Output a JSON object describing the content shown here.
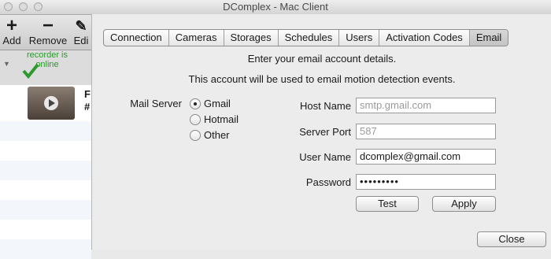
{
  "window": {
    "title": "DComplex - Mac Client"
  },
  "toolbar": {
    "add_label": "Add",
    "remove_label": "Remove",
    "edit_label": "Edi"
  },
  "recorder": {
    "status": "recorder is online"
  },
  "camera": {
    "name_partial": "F",
    "id_partial": "#"
  },
  "tabs": [
    "Connection",
    "Cameras",
    "Storages",
    "Schedules",
    "Users",
    "Activation Codes",
    "Email"
  ],
  "selected_tab": "Email",
  "email": {
    "intro_line1": "Enter your email account details.",
    "intro_line2": "This account will be used to email motion detection events.",
    "mail_server_label": "Mail Server",
    "options": [
      "Gmail",
      "Hotmail",
      "Other"
    ],
    "selected_option": "Gmail",
    "host_name_label": "Host Name",
    "host_name_value": "smtp.gmail.com",
    "server_port_label": "Server Port",
    "server_port_value": "587",
    "user_name_label": "User Name",
    "user_name_value": "dcomplex@gmail.com",
    "password_label": "Password",
    "password_value": "•••••••••",
    "test_label": "Test",
    "apply_label": "Apply",
    "close_label": "Close"
  },
  "colors": {
    "status_green": "#2d9a2d",
    "sheet_bg": "#ececec"
  },
  "icons": [
    "add-icon",
    "remove-icon",
    "checkmark-icon",
    "play-icon"
  ]
}
